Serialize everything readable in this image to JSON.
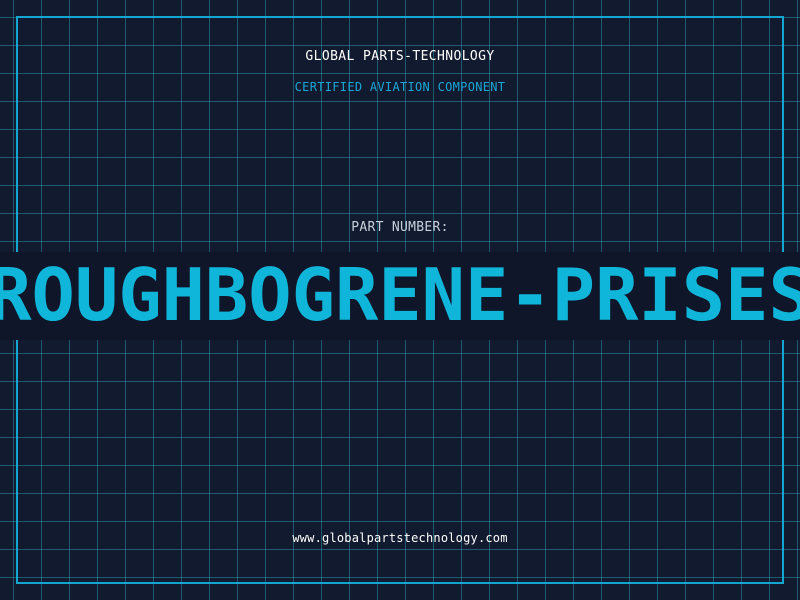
{
  "header": {
    "company_name": "GLOBAL PARTS-TECHNOLOGY",
    "certification": "CERTIFIED AVIATION COMPONENT"
  },
  "part": {
    "label": "PART NUMBER:",
    "number": "ROUGHBOGRENE-PRISES"
  },
  "footer": {
    "website": "www.globalpartstechnology.com"
  },
  "colors": {
    "background": "#111a2e",
    "grid": "#2daabe",
    "frame": "#12a7d3",
    "accent": "#10b6da",
    "text": "#ffffff"
  }
}
